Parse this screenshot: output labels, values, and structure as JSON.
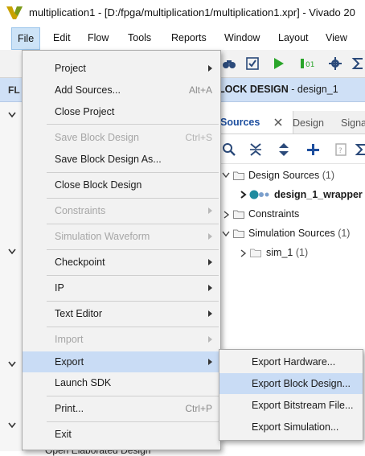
{
  "window": {
    "title": "multiplication1 - [D:/fpga/multiplication1/multiplication1.xpr] - Vivado 20"
  },
  "menubar": [
    "File",
    "Edit",
    "Flow",
    "Tools",
    "Reports",
    "Window",
    "Layout",
    "View"
  ],
  "banner": {
    "left_label": "FL",
    "title_prefix": "LOCK DESIGN",
    "title_suffix": " - design_1"
  },
  "sources_panel": {
    "tabs": [
      "Sources",
      "Design",
      "Signa"
    ],
    "tree": [
      {
        "label": "Design Sources",
        "count": "(1)"
      },
      {
        "label": "design_1_wrapper",
        "suffix": "("
      },
      {
        "label": "Constraints"
      },
      {
        "label": "Simulation Sources",
        "count": "(1)"
      },
      {
        "label": "sim_1",
        "count": "(1)"
      }
    ]
  },
  "left_panel": {
    "partial_label": "Open Elaborated Design"
  },
  "file_menu": {
    "items": [
      {
        "label": "Project",
        "submenu": true
      },
      {
        "label": "Add Sources...",
        "shortcut": "Alt+A"
      },
      {
        "label": "Close Project"
      },
      {
        "label": "Save Block Design",
        "shortcut": "Ctrl+S",
        "disabled": true
      },
      {
        "label": "Save Block Design As..."
      },
      {
        "label": "Close Block Design"
      },
      {
        "label": "Constraints",
        "submenu": true,
        "disabled": true
      },
      {
        "label": "Simulation Waveform",
        "submenu": true,
        "disabled": true
      },
      {
        "label": "Checkpoint",
        "submenu": true
      },
      {
        "label": "IP",
        "submenu": true
      },
      {
        "label": "Text Editor",
        "submenu": true
      },
      {
        "label": "Import",
        "submenu": true,
        "disabled": true
      },
      {
        "label": "Export",
        "submenu": true,
        "highlighted": true
      },
      {
        "label": "Launch SDK"
      },
      {
        "label": "Print...",
        "shortcut": "Ctrl+P"
      },
      {
        "label": "Exit"
      }
    ]
  },
  "export_submenu": {
    "items": [
      {
        "label": "Export Hardware..."
      },
      {
        "label": "Export Block Design...",
        "highlighted": true
      },
      {
        "label": "Export Bitstream File..."
      },
      {
        "label": "Export Simulation..."
      }
    ]
  },
  "colors": {
    "highlight": "#c9dcf5",
    "banner": "#cfe0f6",
    "accent_green": "#2aa52a",
    "accent_blue": "#1d4e9e"
  }
}
